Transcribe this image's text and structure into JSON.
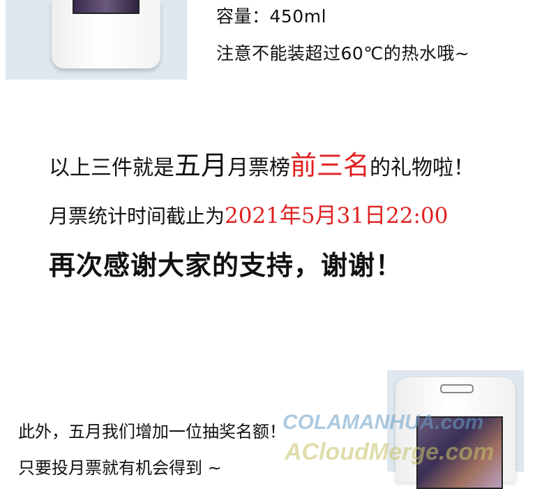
{
  "product": {
    "capacity": "容量：450ml",
    "warning": "注意不能装超过60℃的热水哦~"
  },
  "announcement": {
    "line1_a": "以上三件就是",
    "line1_b": "五月",
    "line1_c": "月票榜",
    "line1_d": "前三名",
    "line1_e": "的礼物啦！",
    "line2_a": "月票统计时间截止为",
    "line2_b": "2021年5月31日22:00",
    "line3": "再次感谢大家的支持，谢谢！"
  },
  "extra": {
    "line1": "此外，五月我们增加一位抽奖名额！",
    "line2": "只要投月票就有机会得到 ~"
  },
  "watermark": {
    "line1": "COLAMANHUA.com",
    "line2": "ACloudMerge.com"
  },
  "colors": {
    "highlight": "#e02020",
    "panel": "#dfe7ef"
  }
}
